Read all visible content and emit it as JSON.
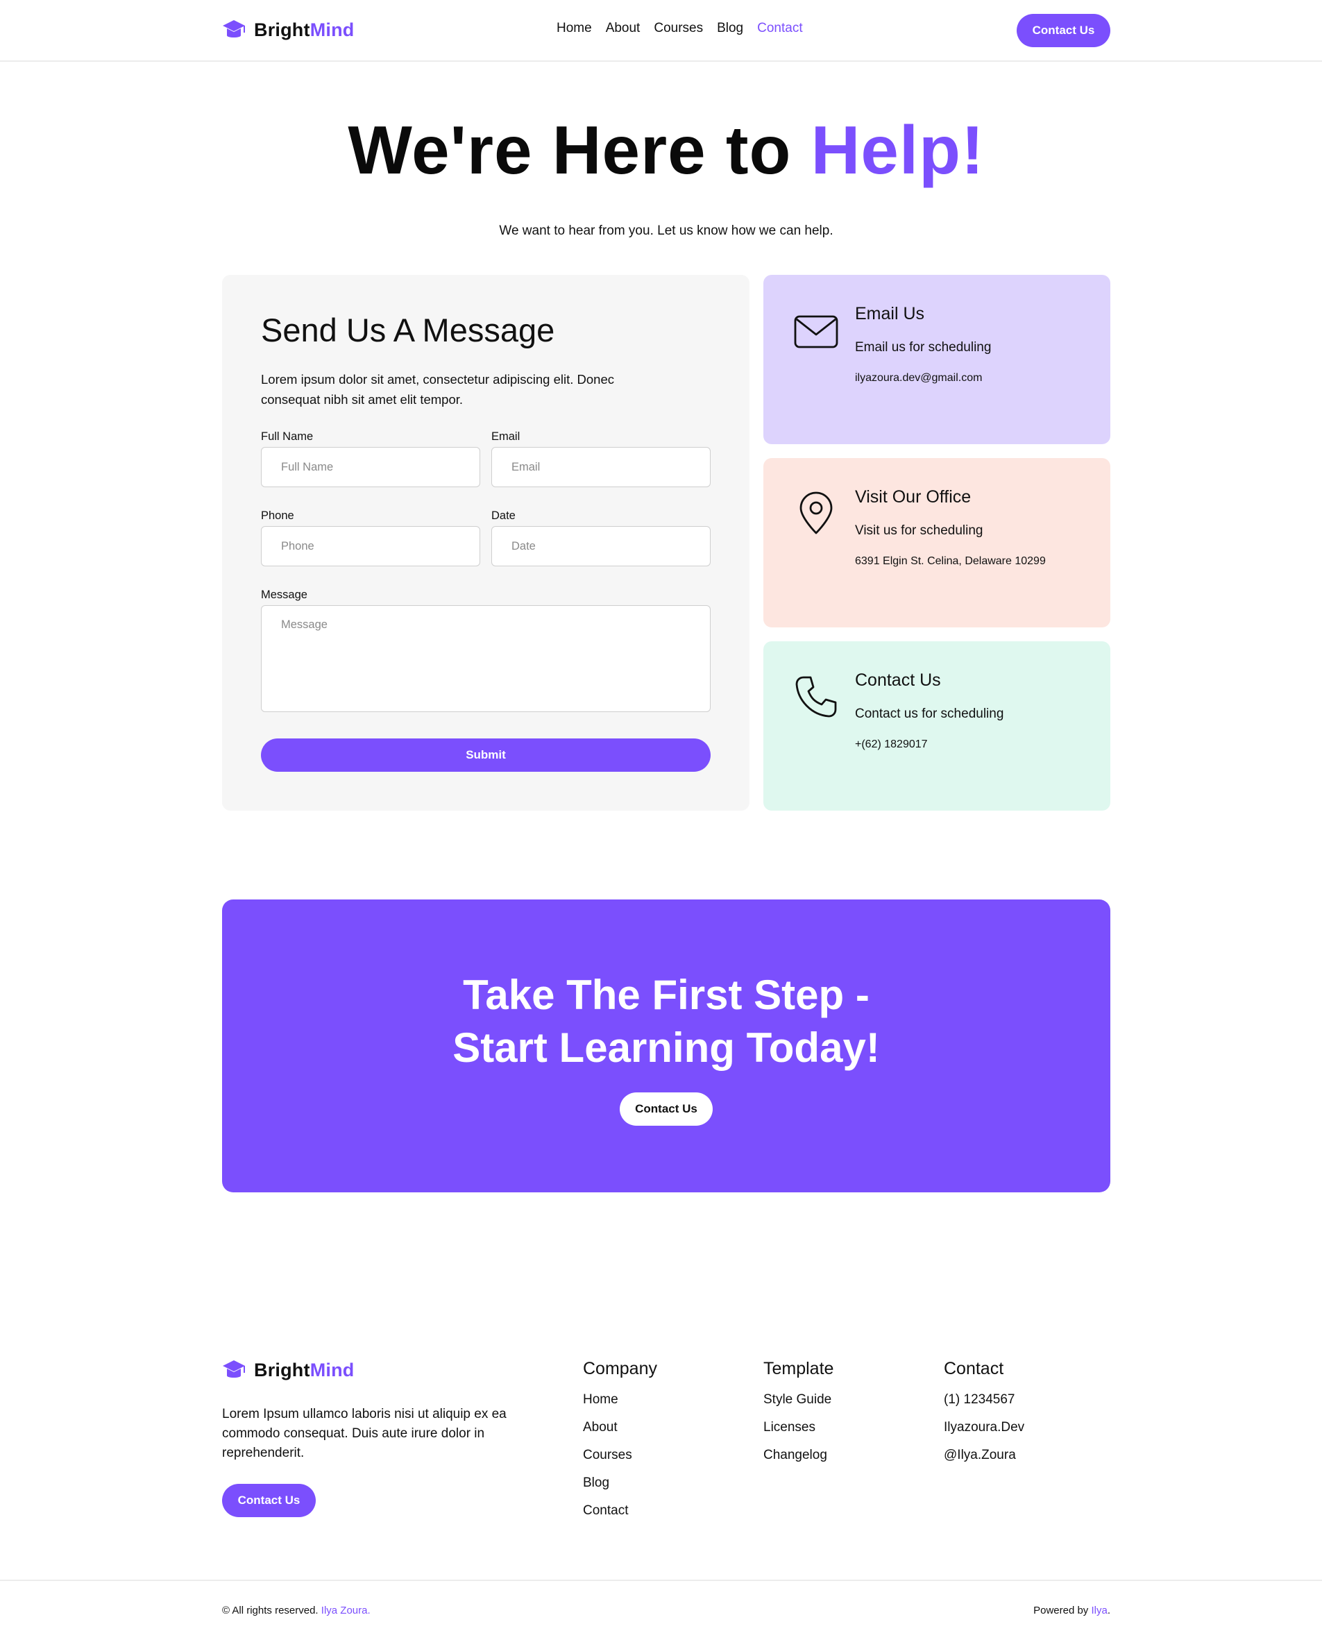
{
  "brand": {
    "name_part1": "Bright",
    "name_part2": "Mind"
  },
  "nav": {
    "items": [
      "Home",
      "About",
      "Courses",
      "Blog",
      "Contact"
    ],
    "active": "Contact",
    "cta_label": "Contact Us"
  },
  "hero": {
    "title_main": "We're Here to ",
    "title_accent": "Help!",
    "subtitle": "We want to hear from you. Let us know how we can help."
  },
  "form": {
    "title": "Send Us A Message",
    "description": "Lorem ipsum dolor sit amet, consectetur adipiscing elit. Donec consequat nibh sit amet elit tempor.",
    "fields": {
      "full_name": {
        "label": "Full Name",
        "placeholder": "Full Name"
      },
      "email": {
        "label": "Email",
        "placeholder": "Email"
      },
      "phone": {
        "label": "Phone",
        "placeholder": "Phone"
      },
      "date": {
        "label": "Date",
        "placeholder": "Date"
      },
      "message": {
        "label": "Message",
        "placeholder": "Message"
      }
    },
    "submit_label": "Submit"
  },
  "info_cards": [
    {
      "title": "Email Us",
      "subtitle": "Email us for scheduling",
      "value": "ilyazoura.dev@gmail.com",
      "icon": "envelope-icon",
      "bg": "#ddd3fd"
    },
    {
      "title": "Visit Our Office",
      "subtitle": "Visit us for scheduling",
      "value": "6391 Elgin St. Celina, Delaware 10299",
      "icon": "map-pin-icon",
      "bg": "#fde6e0"
    },
    {
      "title": "Contact Us",
      "subtitle": "Contact us for scheduling",
      "value": "+(62) 1829017",
      "icon": "phone-icon",
      "bg": "#dff8ef"
    }
  ],
  "cta": {
    "title_line1": "Take The First Step -",
    "title_line2": "Start Learning Today!",
    "button_label": "Contact Us"
  },
  "footer": {
    "description": "Lorem Ipsum ullamco laboris nisi ut aliquip ex ea commodo consequat. Duis aute irure dolor in reprehenderit.",
    "button_label": "Contact Us",
    "columns": [
      {
        "title": "Company",
        "links": [
          "Home",
          "About",
          "Courses",
          "Blog",
          "Contact"
        ]
      },
      {
        "title": "Template",
        "links": [
          "Style Guide",
          "Licenses",
          "Changelog"
        ]
      },
      {
        "title": "Contact",
        "links": [
          "(1) 1234567",
          "Ilyazoura.Dev",
          "@Ilya.Zoura"
        ]
      }
    ],
    "copyright_prefix": "© All rights reserved. ",
    "copyright_name": "Ilya Zoura.",
    "powered_prefix": "Powered by ",
    "powered_name": "Ilya",
    "powered_suffix": "."
  },
  "colors": {
    "accent": "#7b4ffd",
    "form_bg": "#f6f6f6"
  }
}
